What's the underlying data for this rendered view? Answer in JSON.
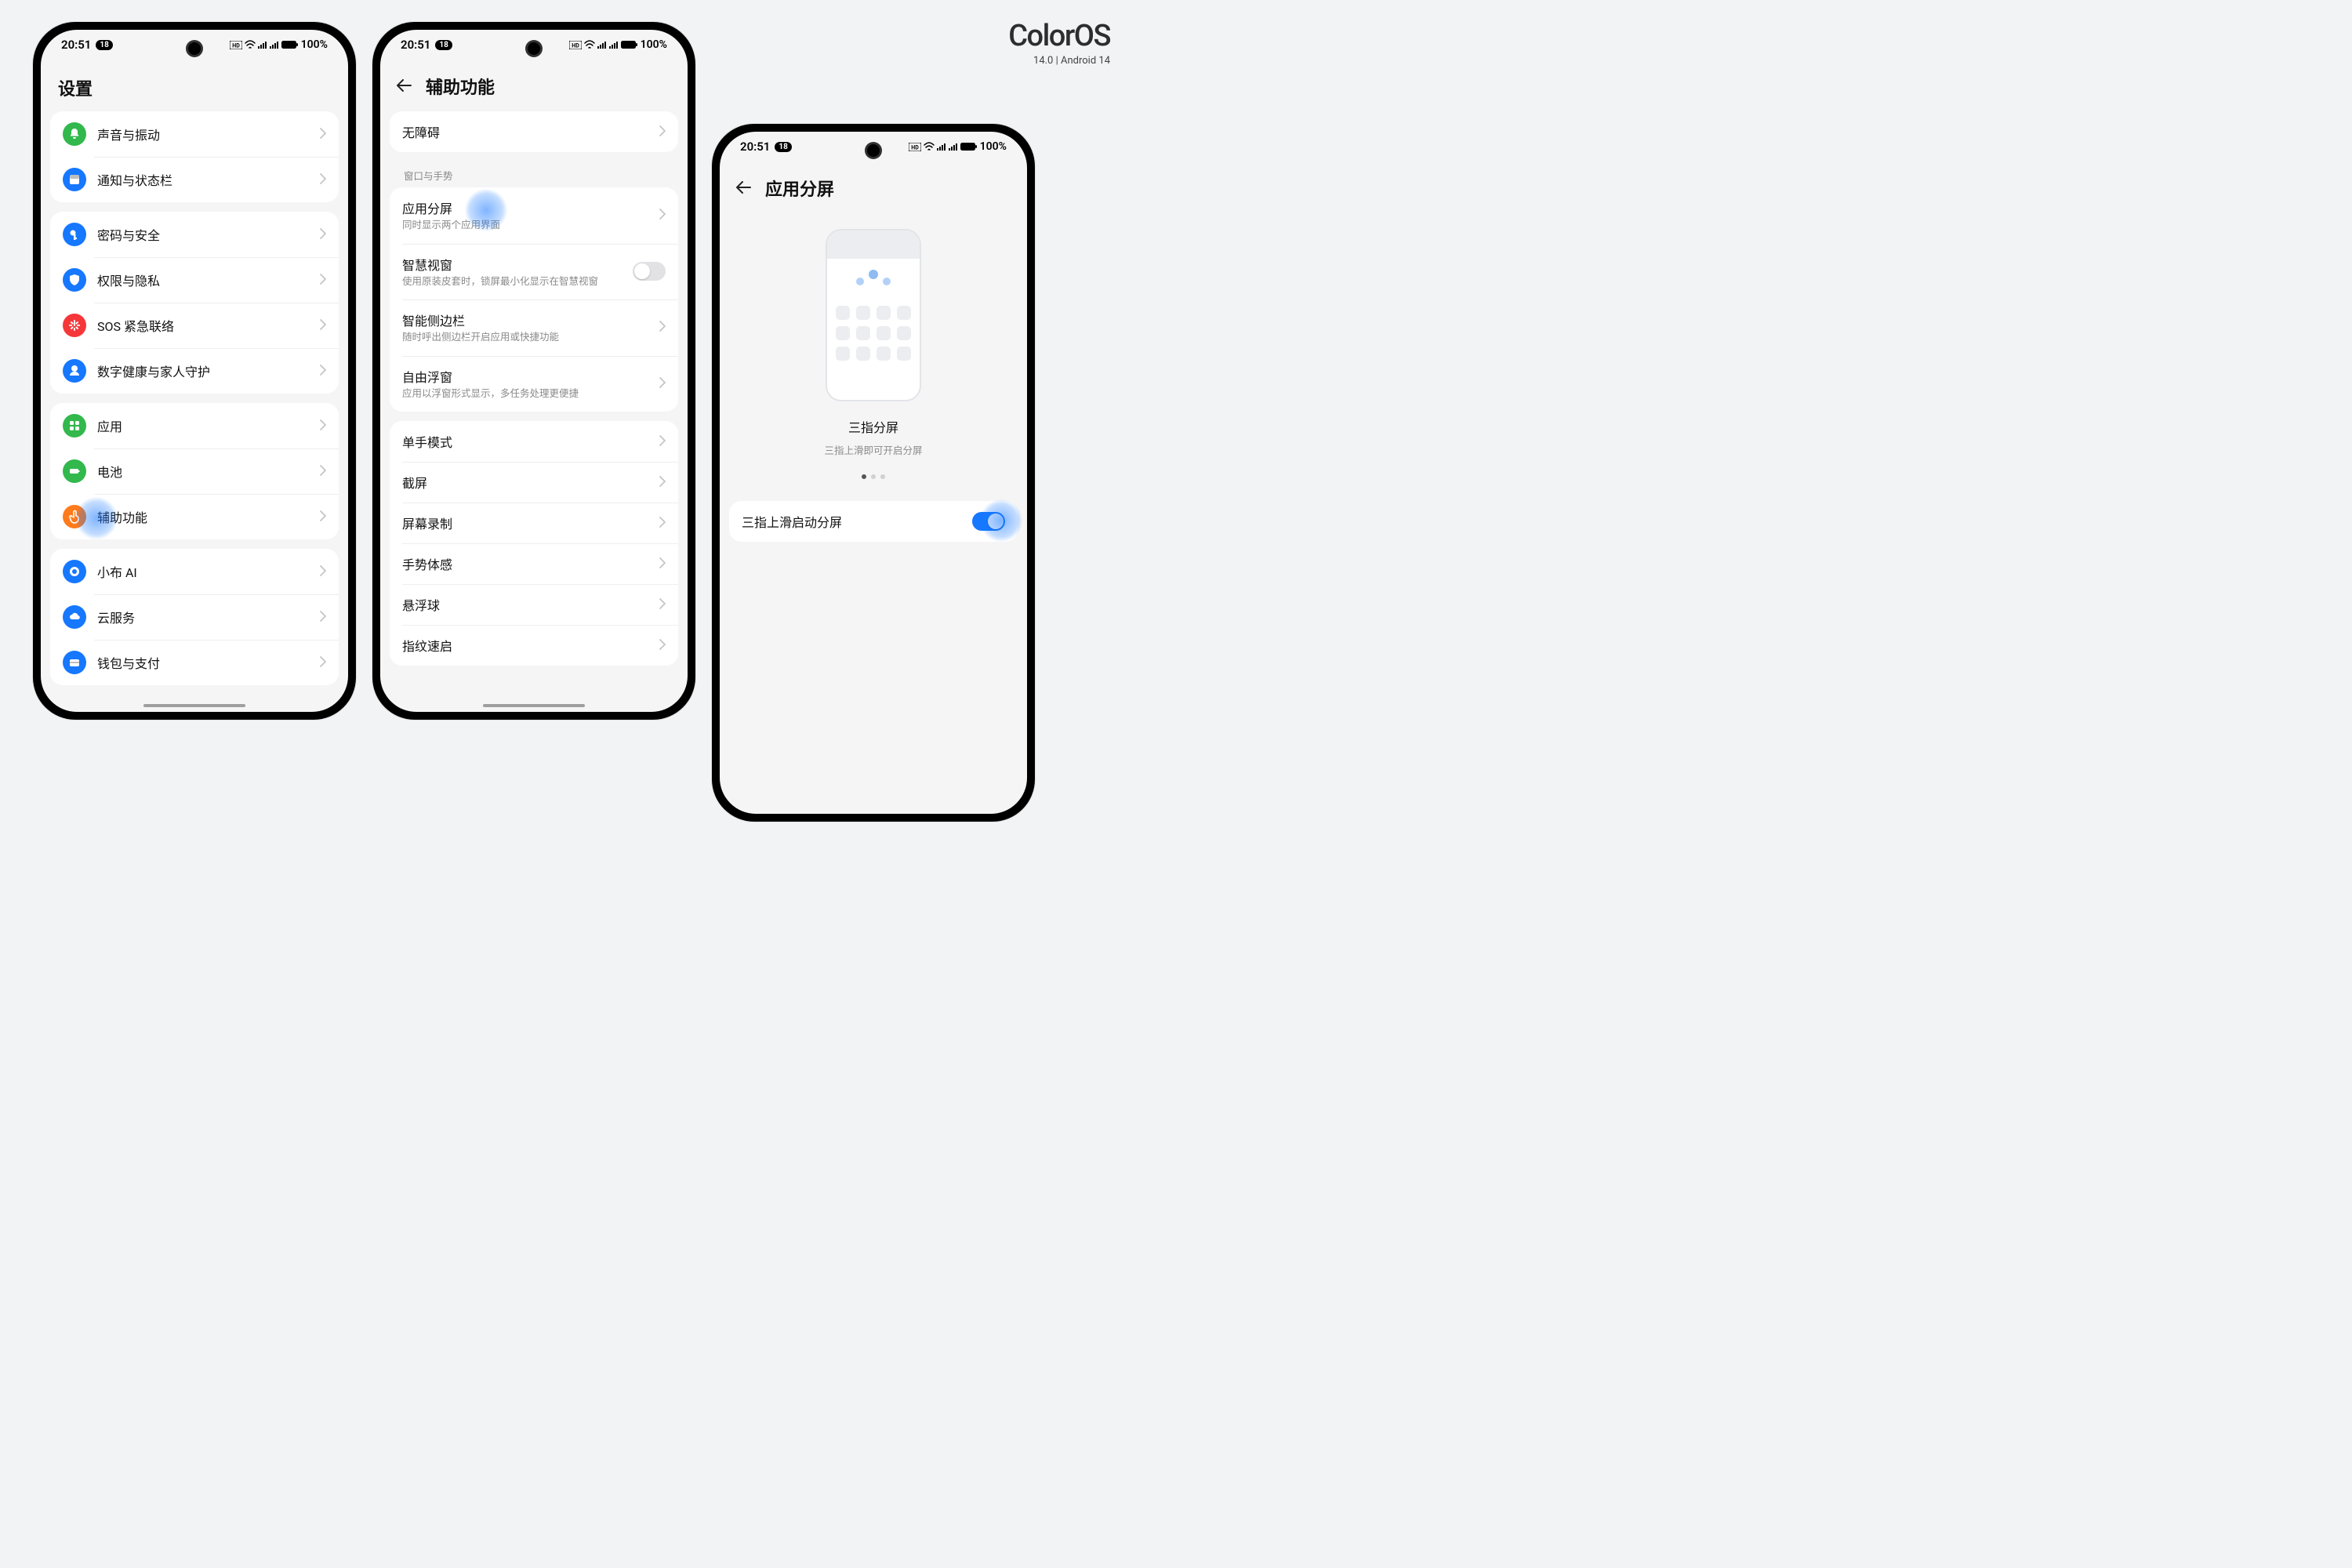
{
  "brand": {
    "name": "ColorOS",
    "sub": "14.0 | Android 14"
  },
  "statusbar": {
    "time": "20:51",
    "badge": "18",
    "battery": "100%"
  },
  "colors": {
    "green": "#32b84c",
    "blue": "#1677ff",
    "red": "#f5373a",
    "orange": "#ff7b1c"
  },
  "phone1": {
    "title": "设置",
    "groups": [
      {
        "items": [
          {
            "icon": "bell-icon",
            "color": "green",
            "label": "声音与振动"
          },
          {
            "icon": "panel-icon",
            "color": "blue",
            "label": "通知与状态栏"
          }
        ]
      },
      {
        "items": [
          {
            "icon": "key-icon",
            "color": "blue",
            "label": "密码与安全"
          },
          {
            "icon": "shield-icon",
            "color": "blue",
            "label": "权限与隐私"
          },
          {
            "icon": "sos-icon",
            "color": "red",
            "label": "SOS 紧急联络"
          },
          {
            "icon": "heart-icon",
            "color": "blue",
            "label": "数字健康与家人守护"
          }
        ]
      },
      {
        "items": [
          {
            "icon": "apps-icon",
            "color": "green",
            "label": "应用"
          },
          {
            "icon": "battery-icon",
            "color": "green",
            "label": "电池"
          },
          {
            "icon": "touch-icon",
            "color": "orange",
            "label": "辅助功能",
            "highlight": true
          }
        ]
      },
      {
        "items": [
          {
            "icon": "ai-icon",
            "color": "blue",
            "label": "小布 AI"
          },
          {
            "icon": "cloud-icon",
            "color": "blue",
            "label": "云服务"
          },
          {
            "icon": "wallet-icon",
            "color": "blue",
            "label": "钱包与支付"
          }
        ]
      }
    ]
  },
  "phone2": {
    "title": "辅助功能",
    "card_accessibility": {
      "label": "无障碍"
    },
    "section_label": "窗口与手势",
    "window_items": [
      {
        "label": "应用分屏",
        "desc": "同时显示两个应用界面",
        "chev": true,
        "highlight": true
      },
      {
        "label": "智慧视窗",
        "desc": "使用原装皮套时，锁屏最小化显示在智慧视窗",
        "toggle": false
      },
      {
        "label": "智能侧边栏",
        "desc": "随时呼出侧边栏开启应用或快捷功能",
        "chev": true
      },
      {
        "label": "自由浮窗",
        "desc": "应用以浮窗形式显示，多任务处理更便捷",
        "chev": true
      }
    ],
    "more_items": [
      {
        "label": "单手模式"
      },
      {
        "label": "截屏"
      },
      {
        "label": "屏幕录制"
      },
      {
        "label": "手势体感"
      },
      {
        "label": "悬浮球"
      },
      {
        "label": "指纹速启"
      }
    ]
  },
  "phone3": {
    "title": "应用分屏",
    "illus_title": "三指分屏",
    "illus_desc": "三指上滑即可开启分屏",
    "toggle_row": {
      "label": "三指上滑启动分屏",
      "on": true,
      "highlight": true
    }
  }
}
